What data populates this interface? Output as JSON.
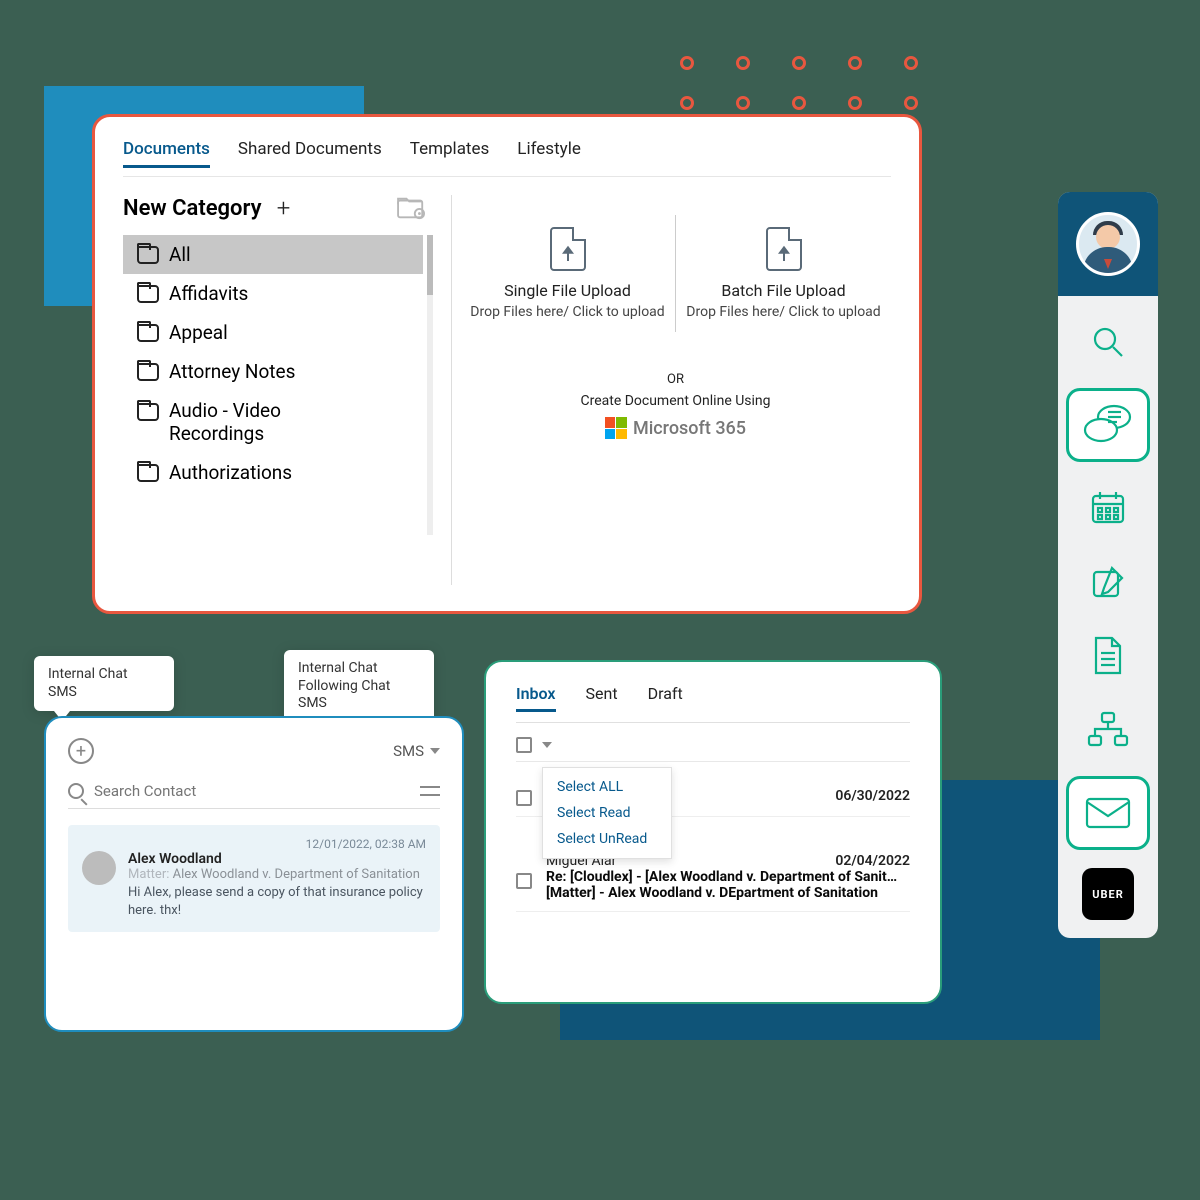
{
  "docs": {
    "tabs": [
      "Documents",
      "Shared Documents",
      "Templates",
      "Lifestyle"
    ],
    "new_category": "New Category",
    "categories": [
      "All",
      "Affidavits",
      "Appeal",
      "Attorney Notes",
      "Audio - Video Recordings",
      "Authorizations"
    ],
    "single_upload": {
      "title": "Single File Upload",
      "sub": "Drop Files here/ Click to upload"
    },
    "batch_upload": {
      "title": "Batch File Upload",
      "sub": "Drop Files here/ Click to upload"
    },
    "or": "OR",
    "create_online": "Create Document Online Using",
    "ms365": "Microsoft 365"
  },
  "chat": {
    "bubble1": "Internal Chat\nSMS",
    "bubble2": "Internal Chat\nFollowing Chat\nSMS",
    "sms_label": "SMS",
    "search_placeholder": "Search Contact",
    "msg": {
      "time": "12/01/2022, 02:38 AM",
      "name": "Alex Woodland",
      "matter_label": "Matter:",
      "matter": "Alex Woodland v. Department of Sanitation",
      "text": "Hi Alex, please send a copy of that insurance policy here. thx!"
    }
  },
  "inbox": {
    "tabs": [
      "Inbox",
      "Sent",
      "Draft"
    ],
    "dropdown": [
      "Select ALL",
      "Select Read",
      "Select UnRead"
    ],
    "row1_date": "06/30/2022",
    "row2": {
      "from": "Miguel Alar",
      "date": "02/04/2022",
      "subject": "Re: [Cloudlex] - [Alex Woodland v. Department of Sanit…",
      "detail": "[Matter] - Alex Woodland v. DEpartment of Sanitation"
    }
  },
  "sidebar": {
    "uber": "UBER"
  }
}
